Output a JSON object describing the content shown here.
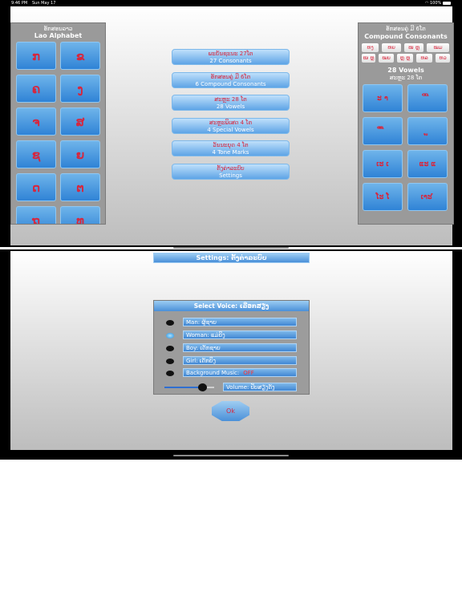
{
  "status_bar": {
    "time": "9:46 PM",
    "date": "Sun May 17",
    "battery": "100%"
  },
  "left_panel": {
    "title_lao": "ອັກສອນລາວ",
    "title_en": "Lao Alphabet",
    "letters": [
      "ກ",
      "ຂ",
      "ຄ",
      "ງ",
      "ຈ",
      "ສ",
      "ຊ",
      "ຍ",
      "ດ",
      "ຕ",
      "ຖ",
      "ທ"
    ]
  },
  "menu": [
    {
      "lao": "ພະຍັນຊະນະ 27ໂຕ",
      "en": "27 Consonants"
    },
    {
      "lao": "ອັກສອນຄູ່ ມີ 6ໂຕ",
      "en": "6 Compound Consonants"
    },
    {
      "lao": "ສະຫຼະ 28 ໂຕ",
      "en": "28 Vowels"
    },
    {
      "lao": "ສະຫຼະພິເສດ 4 ໂຕ",
      "en": "4 Special Vowels"
    },
    {
      "lao": "ວັນນະຍຸດ 4 ໂຕ",
      "en": "4 Tone Marks"
    },
    {
      "lao": "ຕັ້ງຄ່າລະບົບ",
      "en": "Settings"
    }
  ],
  "right_panel": {
    "title_lao": "ອັກສອນຄູ່ ມີ 6ໂຕ",
    "title_en": "Compound Consonants",
    "compound_row1": [
      "ຫງ",
      "ຫຍ",
      "ໜ ຫຼ",
      "ໝມ"
    ],
    "compound_row2": [
      "ໜ ຫຼ",
      "ໝບ",
      "ຫຼ ຫຼ",
      "ຫລ",
      "ຫວ"
    ],
    "vowels_en": "28 Vowels",
    "vowels_lao": "ສະຫຼະ 28 ໂຕ",
    "vowels": [
      "ະ າ",
      "ິ ີ",
      "ຶ ື",
      "ຸ ູ",
      "ເະ ເ",
      "ແະ ແ",
      "ໂະ ໂ",
      "ເາະ ໍ"
    ]
  },
  "settings": {
    "title": "Settings:",
    "title_lao": "ຕັ້ງຄ່າລະບົບ",
    "voice_title": "Select Voice:",
    "voice_title_lao": "ເລືອກສຽງ",
    "options": [
      {
        "label": "Man:",
        "lao": "ຜູ້ຊາຍ",
        "selected": false
      },
      {
        "label": "Woman:",
        "lao": "ແມ່ຍິງ",
        "selected": true
      },
      {
        "label": "Boy:",
        "lao": "ເດັກຊາຍ",
        "selected": false
      },
      {
        "label": "Girl:",
        "lao": "ເດັກຍິງ",
        "selected": false
      }
    ],
    "music_label": "Background Music:",
    "music_state": "OFF",
    "volume_label": "Volume:",
    "volume_lao": "ປັບສຽງດັງ",
    "volume_level": 0.75,
    "ok_label": "Ok"
  },
  "colors": {
    "accent": "#3f86d3",
    "label_red": "#d7263d"
  }
}
